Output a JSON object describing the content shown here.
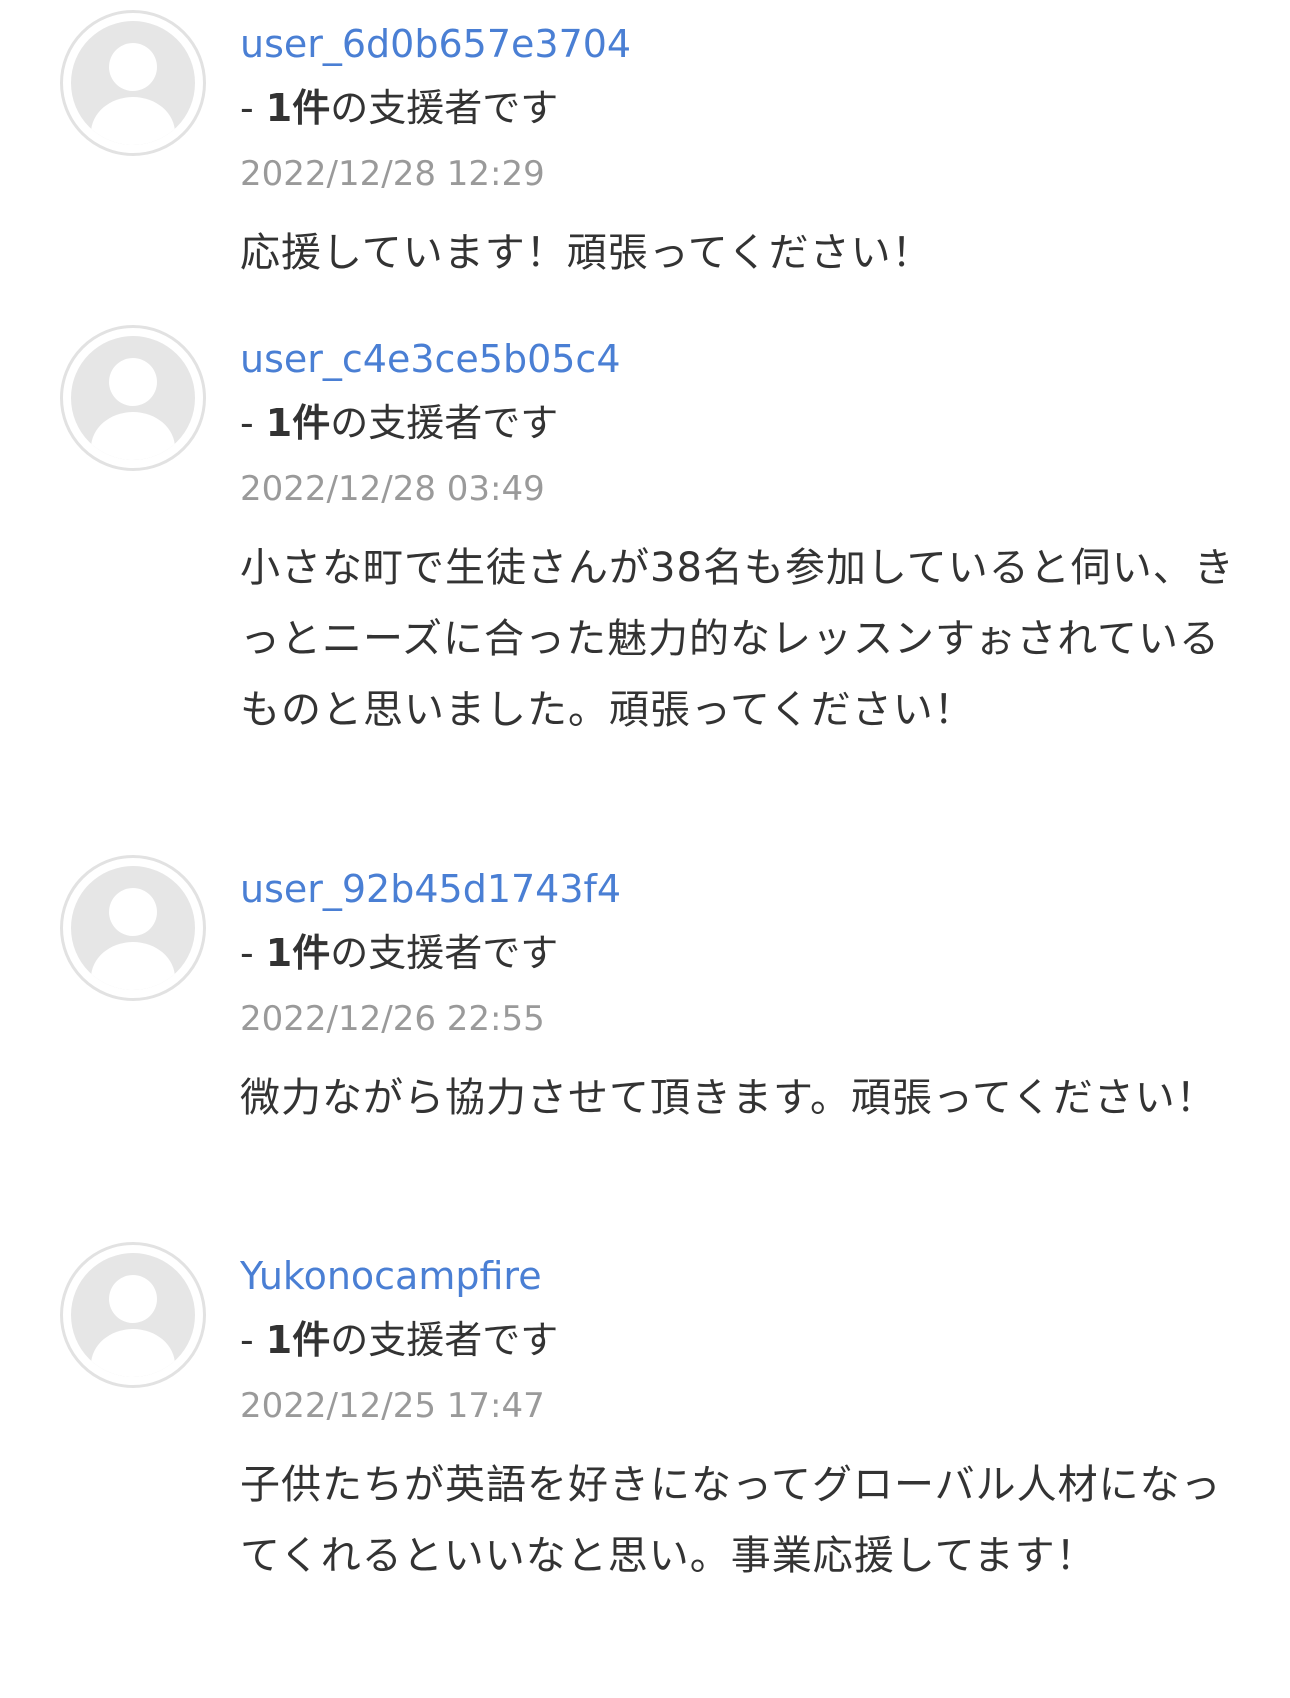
{
  "colors": {
    "username_link": "#4a7fd4",
    "date_text": "#9a9a9a",
    "body_text": "#333333",
    "avatar_bg": "#e6e6e6",
    "avatar_border": "#e2e2e2"
  },
  "comments": [
    {
      "avatar_icon": "user-placeholder-icon",
      "username": "user_6d0b657e3704",
      "supporter_prefix": "- ",
      "supporter_count": "1件",
      "supporter_suffix": "の支援者です",
      "datetime": "2022/12/28 12:29",
      "message": "応援しています！頑張ってください！"
    },
    {
      "avatar_icon": "user-placeholder-icon",
      "username": "user_c4e3ce5b05c4",
      "supporter_prefix": "- ",
      "supporter_count": "1件",
      "supporter_suffix": "の支援者です",
      "datetime": "2022/12/28 03:49",
      "message": "小さな町で生徒さんが38名も参加していると伺い、きっとニーズに合った魅力的なレッスンすぉされているものと思いました。頑張ってください！"
    },
    {
      "avatar_icon": "user-placeholder-icon",
      "username": "user_92b45d1743f4",
      "supporter_prefix": "- ",
      "supporter_count": "1件",
      "supporter_suffix": "の支援者です",
      "datetime": "2022/12/26 22:55",
      "message": "微力ながら協力させて頂きます。頑張ってください！"
    },
    {
      "avatar_icon": "user-placeholder-icon",
      "username": "Yukonocampfire",
      "supporter_prefix": "- ",
      "supporter_count": "1件",
      "supporter_suffix": "の支援者です",
      "datetime": "2022/12/25 17:47",
      "message": "子供たちが英語を好きになってグローバル人材になってくれるといいなと思い。事業応援してます！"
    }
  ]
}
